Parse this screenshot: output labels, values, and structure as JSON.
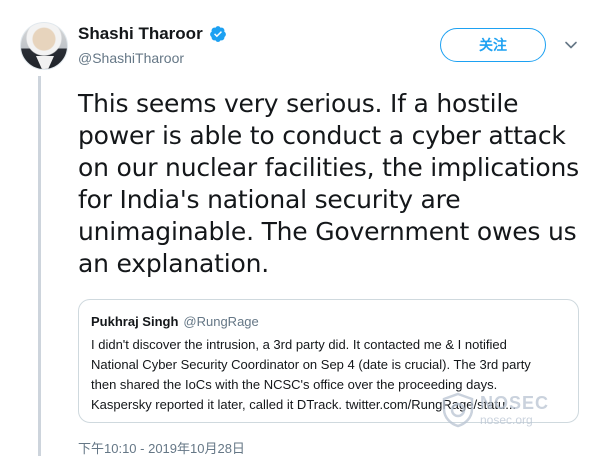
{
  "author": {
    "display_name": "Shashi Tharoor",
    "handle": "@ShashiTharoor",
    "verified": true
  },
  "follow_button": {
    "label": "关注"
  },
  "tweet": {
    "text_lines": [
      "This seems very serious. If a hostile",
      "power is able to conduct a cyber attack",
      "on our nuclear facilities, the implications",
      "for India's national security are",
      "unimaginable. The Government owes us",
      "an explanation."
    ],
    "timestamp": "下午10:10 - 2019年10月28日"
  },
  "quoted_tweet": {
    "display_name": "Pukhraj Singh",
    "handle": "@RungRage",
    "text_lines": [
      "I didn't discover the intrusion, a 3rd party did. It contacted me & I notified",
      "National Cyber Security Coordinator on Sep 4 (date is crucial). The 3rd party",
      "then shared the IoCs with the NCSC's office over the proceeding days.",
      "Kaspersky reported it later, called it DTrack. twitter.com/RungRage/statu..."
    ]
  },
  "watermark": {
    "brand": "NOSEC",
    "site": "nosec.org"
  },
  "colors": {
    "accent": "#1da1f2",
    "text": "#14171a",
    "secondary": "#657786",
    "thread_line": "#cdd4dc"
  },
  "icons": [
    "verified-badge-icon",
    "chevron-down-icon",
    "shield-icon"
  ]
}
